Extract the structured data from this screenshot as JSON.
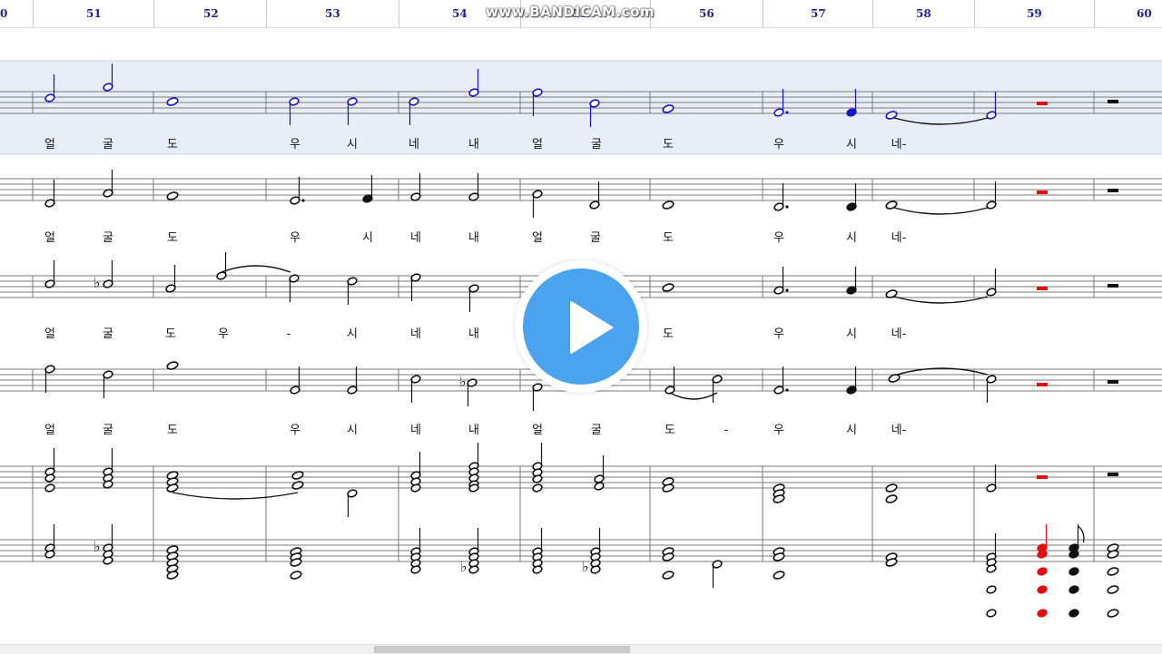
{
  "ruler": {
    "measures": [
      "0",
      "51",
      "52",
      "53",
      "54",
      "55",
      "56",
      "57",
      "58",
      "59",
      "60"
    ]
  },
  "watermark": "www.BANDICAM.com",
  "lyrics": {
    "line1": [
      "얼",
      "굴",
      "도",
      "우",
      "시",
      "네",
      "내",
      "얼",
      "굴",
      "도",
      "우",
      "시",
      "네-"
    ],
    "line2": [
      "얼",
      "굴",
      "도",
      "우",
      "시",
      "네",
      "내",
      "얼",
      "굴",
      "도",
      "우",
      "시",
      "네-"
    ],
    "line3": [
      "얼",
      "굴",
      "도",
      "우",
      "-",
      "시",
      "네",
      "내",
      "도",
      "우",
      "시",
      "네-"
    ],
    "line4": [
      "얼",
      "굴",
      "도",
      "우",
      "시",
      "네",
      "내",
      "얼",
      "굴",
      "도",
      "-",
      "우",
      "시",
      "네-"
    ]
  },
  "colors": {
    "selected_staff_bg": "#e9edf7",
    "selected_notes": "#1414c8",
    "rest_highlight": "#e01010",
    "ruler_numbers": "#1a1f9a",
    "play_button": "#4aa3ee"
  },
  "icons": {
    "play": "play-icon"
  }
}
